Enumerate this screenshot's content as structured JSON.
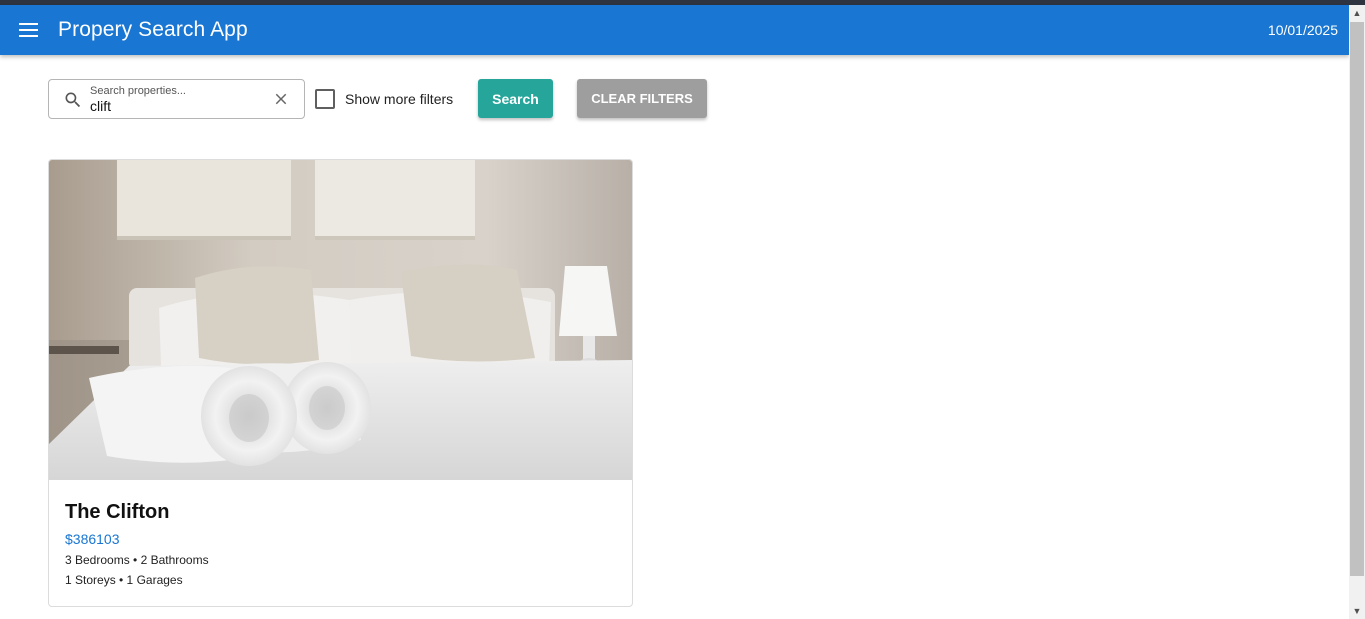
{
  "appbar": {
    "title": "Propery Search App",
    "date": "10/01/2025",
    "color": "#1976d2"
  },
  "search": {
    "label": "Search properties...",
    "value": "clift"
  },
  "filters": {
    "more_filters_label": "Show more filters",
    "more_filters_checked": false
  },
  "buttons": {
    "search_label": "Search",
    "clear_label": "CLEAR FILTERS",
    "search_color": "#26a69a",
    "clear_color": "#9e9e9e"
  },
  "results": [
    {
      "title": "The Clifton",
      "price": "$386103",
      "rooms": "3 Bedrooms • 2 Bathrooms",
      "storeys": "1 Storeys • 1 Garages"
    }
  ],
  "icons": [
    "menu-icon",
    "search-icon",
    "close-icon"
  ]
}
